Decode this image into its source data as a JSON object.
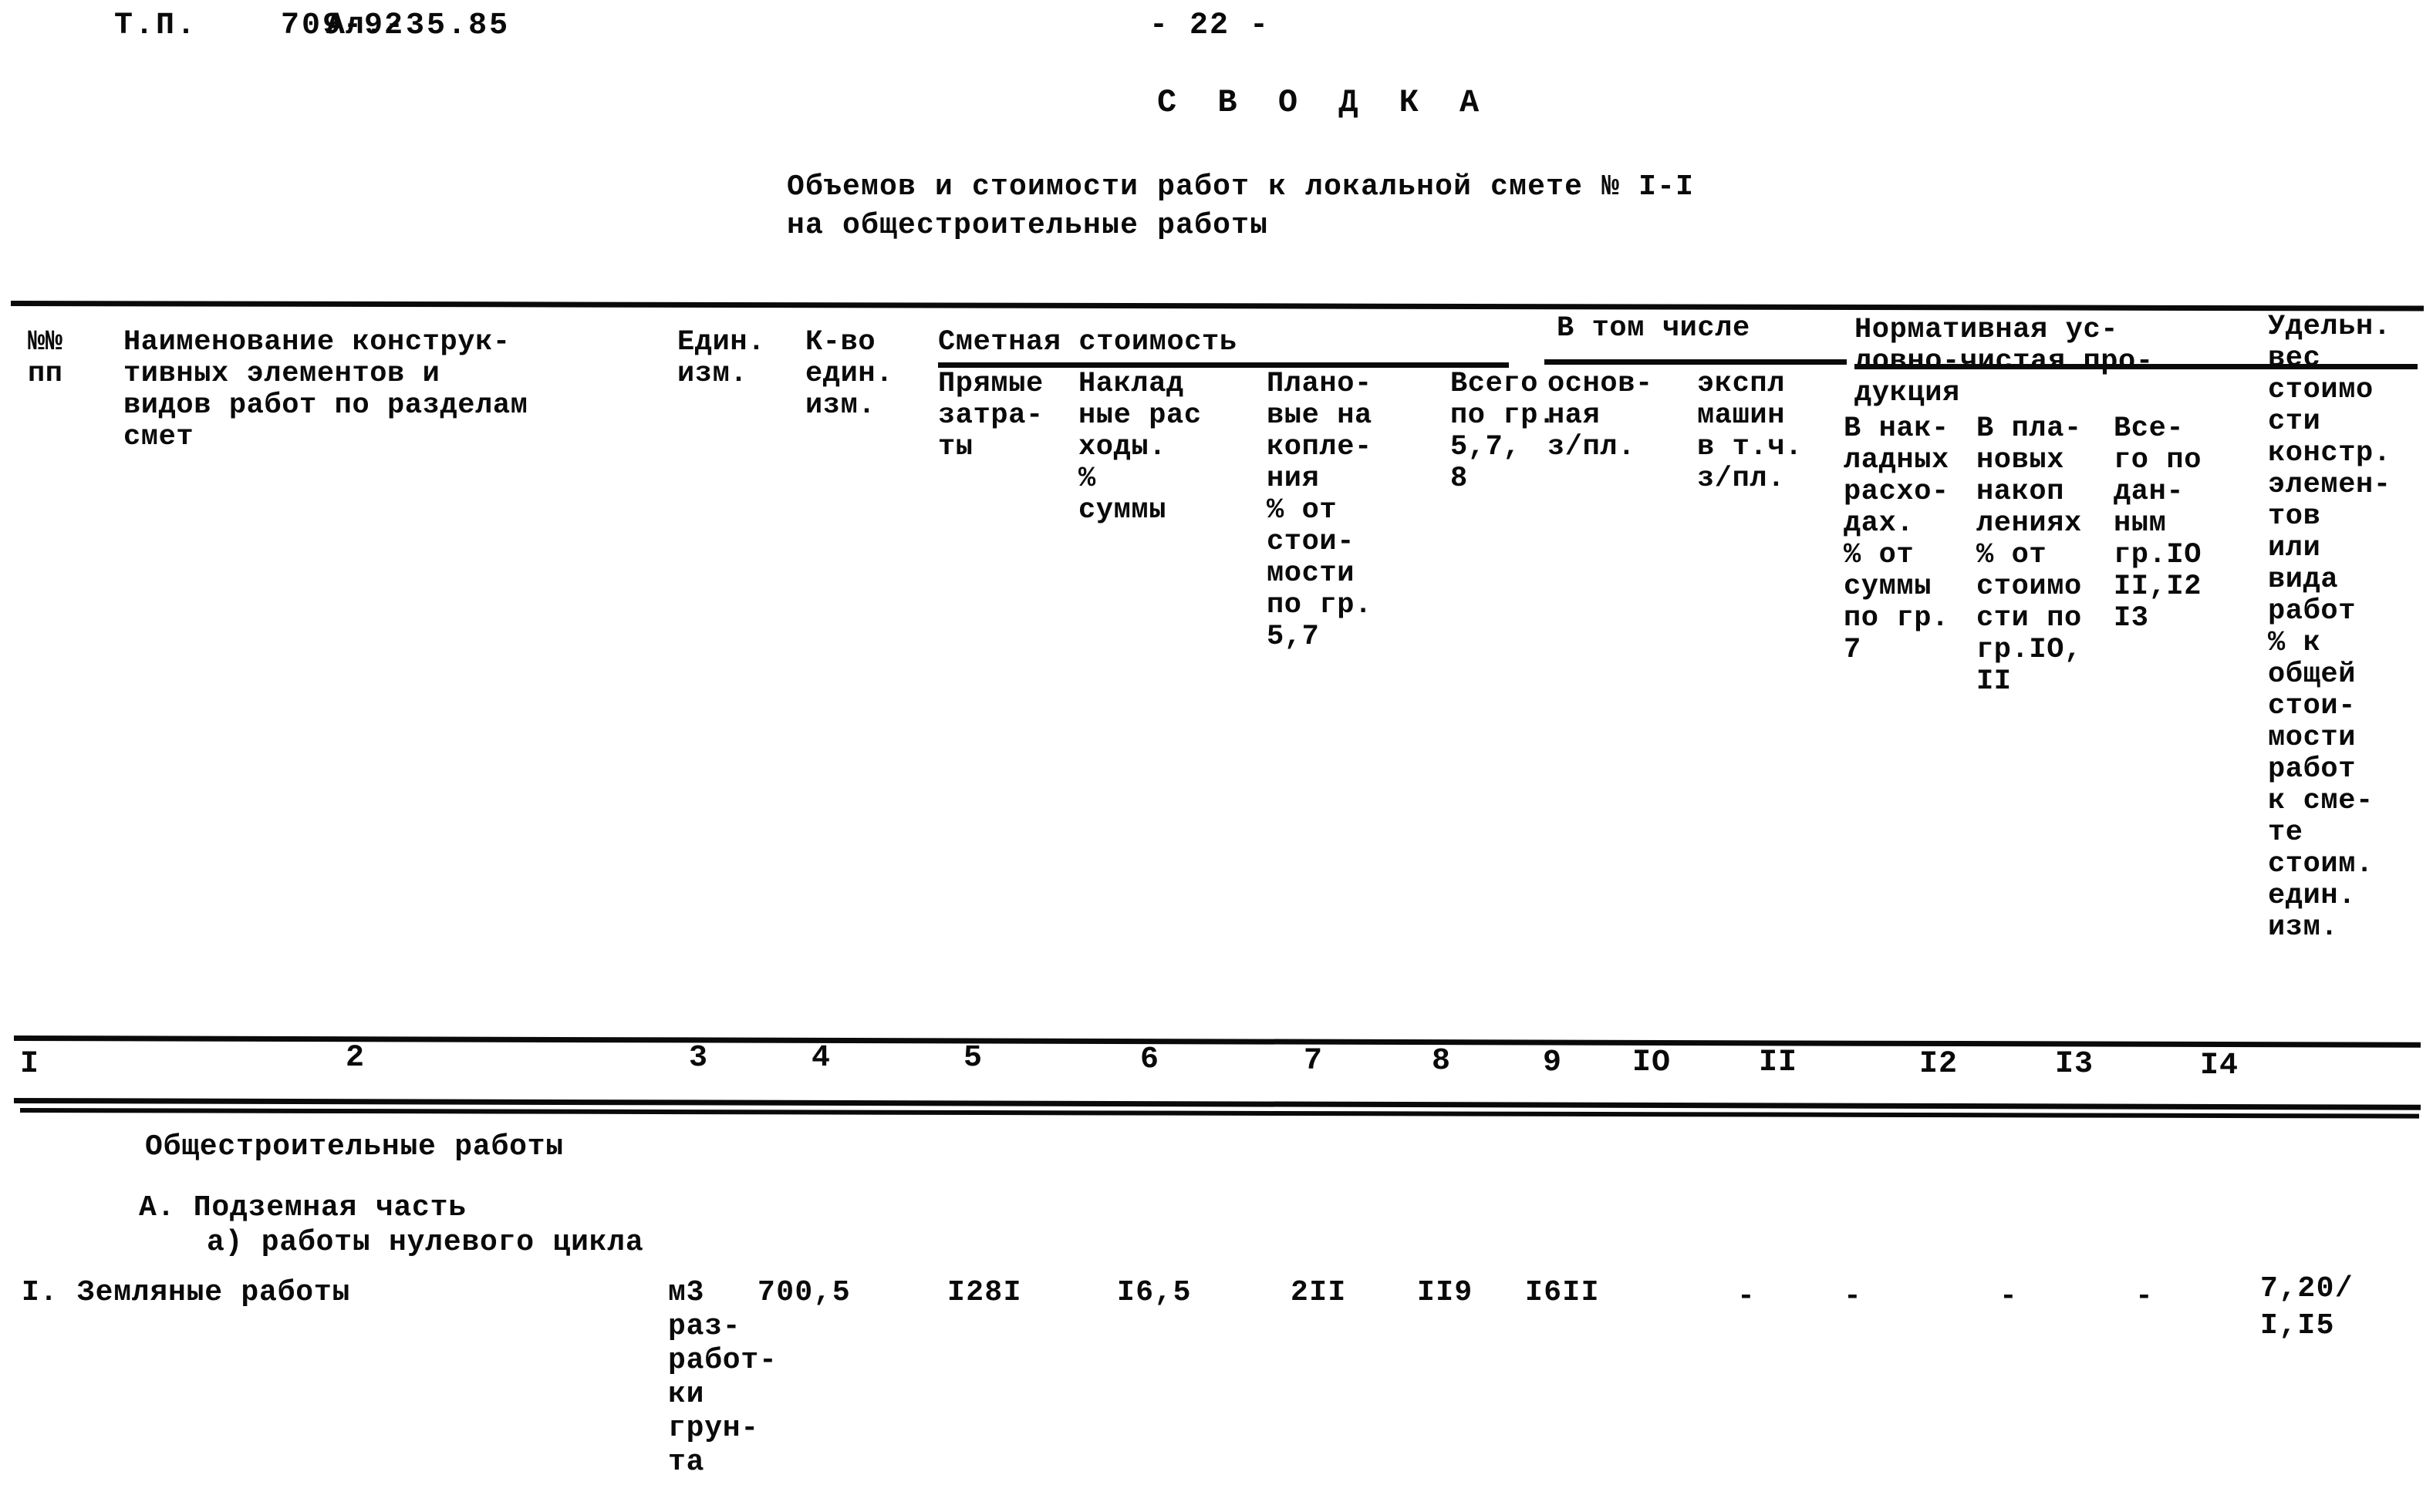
{
  "header": {
    "doc_code": "Т.П.    709-9-35.85",
    "sheet": "Ал.2",
    "page": "- 22 -",
    "title": "С В О Д К А",
    "subtitle_line1": "Объемов и стоимости работ к локальной смете № I-I",
    "subtitle_line2": "на общестроительные работы"
  },
  "table": {
    "group_headers": {
      "smetnaya_stoimost": "Сметная стоимость",
      "v_tom_chisle": "В том числе",
      "normativnaya": "Нормативная ус-\nловно-чистая про-\nдукция"
    },
    "column_headers": {
      "c1": "№№\nпп",
      "c2": "Наименование конструк-\nтивных элементов и\nвидов работ по разделам\nсмет",
      "c3": "Един.\nизм.",
      "c4": "К-во\nедин.\nизм.",
      "c5": "Прямые\nзатра-\nты",
      "c6": "Наклад\nные рас\nходы.\n%\nсуммы",
      "c7": "Плано-\nвые на\nкопле-\nния\n% от\nстои-\nмости\nпо гр.\n5,7",
      "c8": "Всего\nпо гр.\n5,7,\n8",
      "c9": "основ-\nная\nз/пл.",
      "c10": "экспл\nмашин\nв т.ч.\nз/пл.",
      "c11": "В нак-\nладных\nрасхо-\nдах.\n% от\nсуммы\nпо гр.\n7",
      "c12": "В пла-\nновых\nнакоп\nлениях\n% от\nстоимо\nсти по\nгр.IО,\nII",
      "c13": "Все-\nго по\nдан-\nным\nгр.IО\nII,I2\nI3",
      "c14": "Удельн.\nвес\nстоимо\nсти\nконстр.\nэлемен-\nтов\nили\nвида\nработ\n% к\nобщей\nстои-\nмости\nработ\nк сме-\nте\nстоим.\nедин.\nизм."
    },
    "column_numbers": [
      "I",
      "2",
      "3",
      "4",
      "5",
      "6",
      "7",
      "8",
      "9",
      "IО",
      "II",
      "I2",
      "I3",
      "I4"
    ],
    "section_rows": [
      {
        "label": "Общестроительные работы"
      },
      {
        "label": "А. Подземная часть"
      },
      {
        "label": "а) работы нулевого цикла"
      }
    ],
    "data_rows": [
      {
        "no": "I.",
        "name": "Земляные работы",
        "unit": "м3\nраз-\nработ-\nки\nгрун-\nта",
        "qty": "700,5",
        "c5": "I28I",
        "c6": "I6,5",
        "c7": "2II",
        "c8": "II9",
        "c9": "I6II",
        "c10": "-",
        "c11": "-",
        "c12": "-",
        "c13": "-",
        "c14": "7,20/\nI,I5"
      }
    ]
  }
}
